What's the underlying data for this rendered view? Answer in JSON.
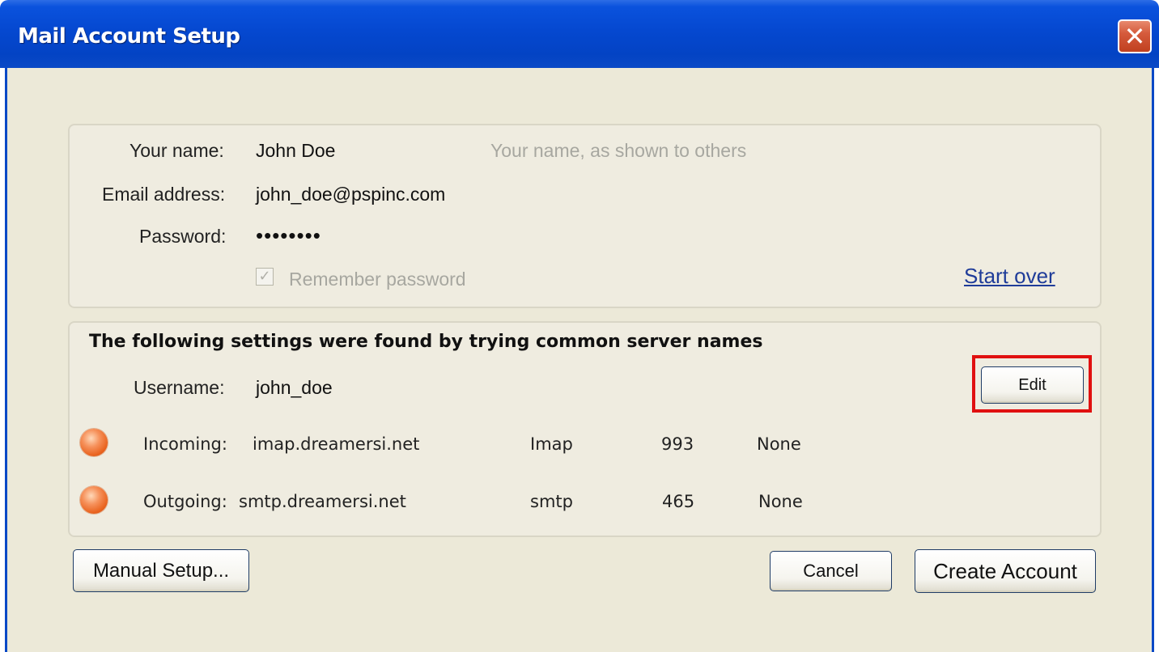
{
  "window": {
    "title": "Mail Account Setup",
    "close_label": "✕"
  },
  "identity": {
    "name_label": "Your name:",
    "name_value": "John Doe",
    "name_hint": "Your name, as shown to others",
    "email_label": "Email address:",
    "email_value": "john_doe@pspinc.com",
    "password_label": "Password:",
    "password_value": "••••••••",
    "remember_label": "Remember password",
    "remember_checked": true,
    "start_over_label": "Start over"
  },
  "settings": {
    "heading": "The following settings were found by trying common server names",
    "username_label": "Username:",
    "username_value": "john_doe",
    "edit_label": "Edit",
    "incoming": {
      "label": "Incoming:",
      "host": "imap.dreamersi.net",
      "protocol": "Imap",
      "port": "993",
      "security": "None"
    },
    "outgoing": {
      "label": "Outgoing:",
      "host": "smtp.dreamersi.net",
      "protocol": "smtp",
      "port": "465",
      "security": "None"
    },
    "status_color": "#e9631f",
    "highlight_color": "#e01010"
  },
  "buttons": {
    "manual_setup": "Manual Setup...",
    "cancel": "Cancel",
    "create_account": "Create Account"
  }
}
